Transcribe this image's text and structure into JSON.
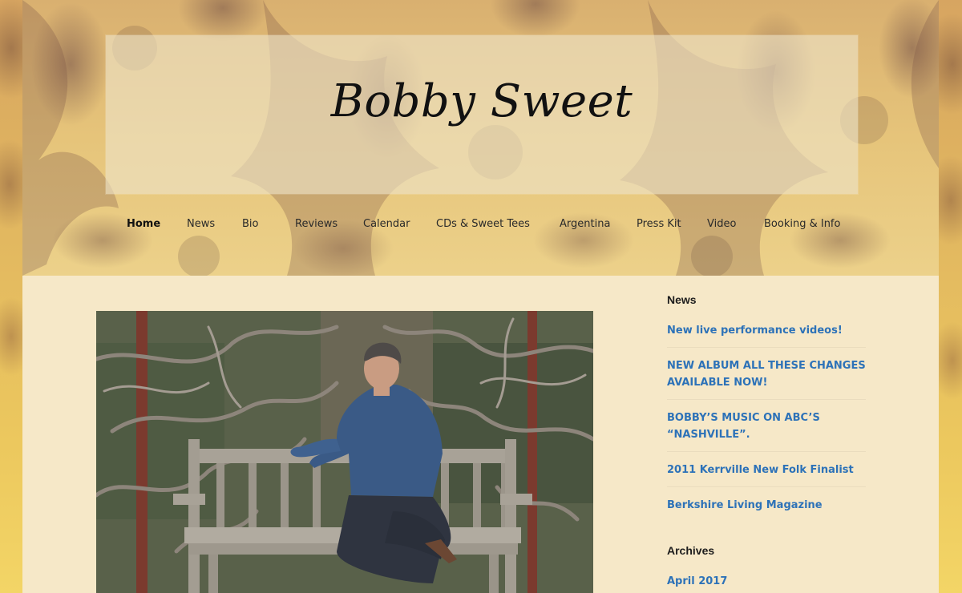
{
  "site": {
    "title": "Bobby Sweet"
  },
  "nav": {
    "items": [
      {
        "label": "Home"
      },
      {
        "label": "News"
      },
      {
        "label": "Bio"
      },
      {
        "label": "Reviews"
      },
      {
        "label": "Calendar"
      },
      {
        "label": "CDs & Sweet Tees"
      },
      {
        "label": "Argentina"
      },
      {
        "label": "Press Kit"
      },
      {
        "label": "Video"
      },
      {
        "label": "Booking & Info"
      }
    ],
    "active": "Home"
  },
  "sidebar": {
    "news": {
      "title": "News",
      "items": [
        {
          "label": "New live performance videos!"
        },
        {
          "label": "NEW ALBUM ALL THESE CHANGES AVAILABLE NOW!"
        },
        {
          "label": "BOBBY’S MUSIC ON ABC’S “NASHVILLE”."
        },
        {
          "label": "2011 Kerrville New Folk Finalist"
        },
        {
          "label": "Berkshire Living Magazine"
        }
      ]
    },
    "archives": {
      "title": "Archives",
      "items": [
        {
          "label": "April 2017"
        }
      ]
    }
  },
  "colors": {
    "link": "#2d72b8",
    "page_bg": "#f6e8c8",
    "nav_text": "#2a2a2a"
  }
}
